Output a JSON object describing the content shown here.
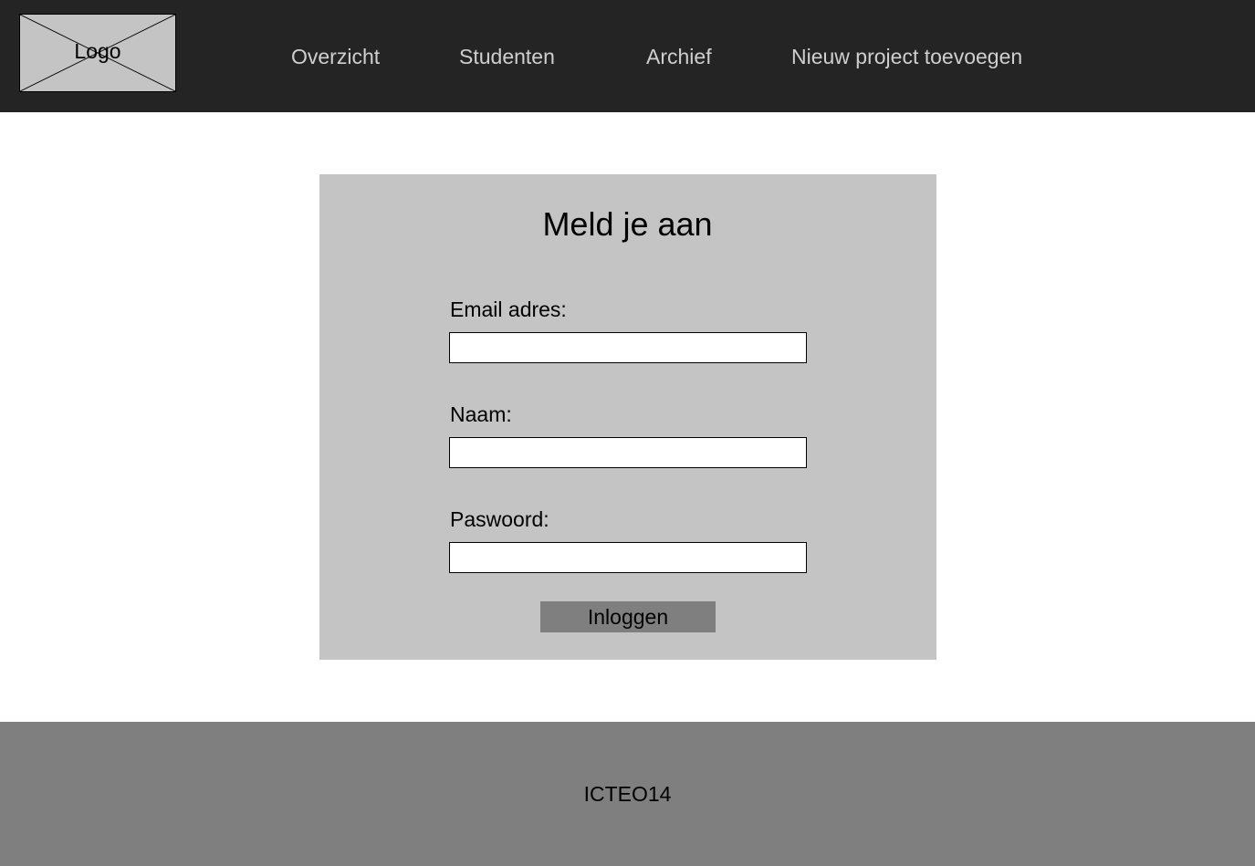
{
  "header": {
    "logo_text": "Logo",
    "nav": {
      "overzicht": "Overzicht",
      "studenten": "Studenten",
      "archief": "Archief",
      "nieuw_project": "Nieuw project toevoegen"
    }
  },
  "login": {
    "title": "Meld je aan",
    "email_label": "Email adres:",
    "email_value": "",
    "name_label": "Naam:",
    "name_value": "",
    "password_label": "Paswoord:",
    "password_value": "",
    "submit_label": "Inloggen"
  },
  "footer": {
    "text": "ICTEO14"
  },
  "colors": {
    "navbar_bg": "#242424",
    "nav_text": "#cfcfcf",
    "card_bg": "#c4c4c4",
    "button_bg": "#7f7f7f",
    "footer_bg": "#7f7f7f"
  }
}
